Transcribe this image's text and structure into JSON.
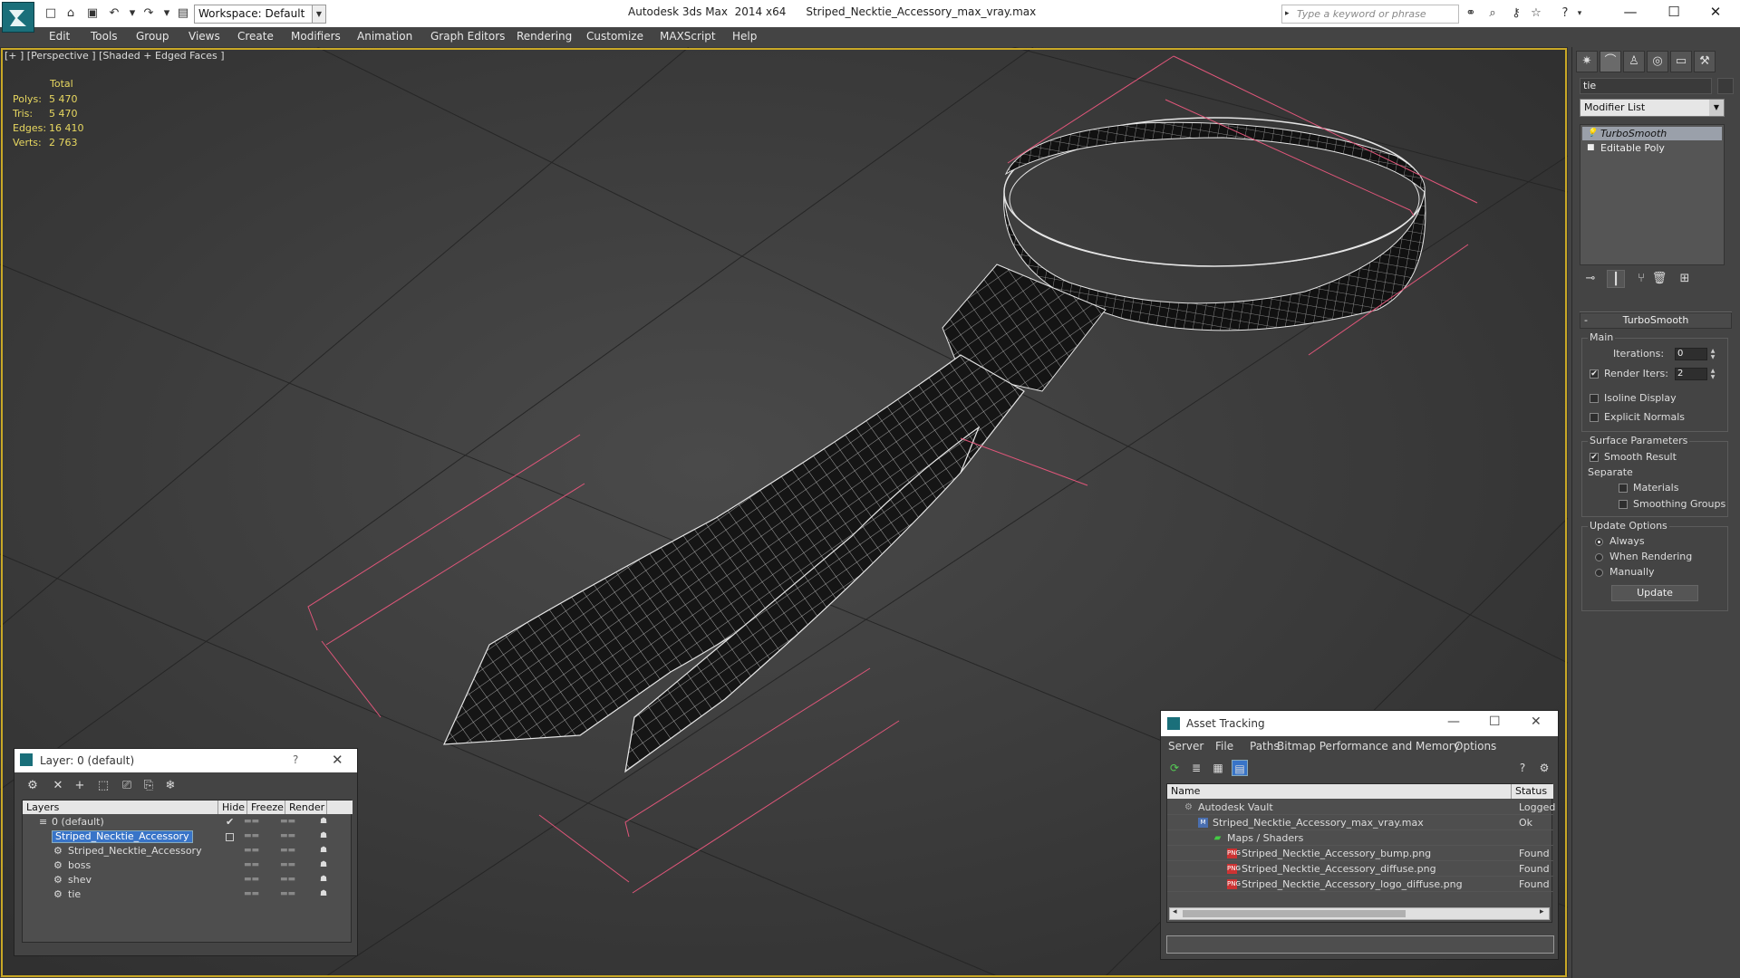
{
  "titlebar": {
    "app": "Autodesk 3ds Max  2014 x64",
    "file": "Striped_Necktie_Accessory_max_vray.max",
    "workspace": "Workspace: Default",
    "search_placeholder": "Type a keyword or phrase",
    "icons": [
      "new-icon",
      "open-icon",
      "save-icon",
      "undo-icon",
      "redo-icon",
      "project-icon"
    ],
    "right_tools": [
      "binoculars-icon",
      "search-icon",
      "key-icon",
      "star-icon",
      "help-icon"
    ],
    "controls": {
      "minimize": "—",
      "maximize": "☐",
      "close": "✕"
    }
  },
  "menu": [
    "Edit",
    "Tools",
    "Group",
    "Views",
    "Create",
    "Modifiers",
    "Animation",
    "Graph Editors",
    "Rendering",
    "Customize",
    "MAXScript",
    "Help"
  ],
  "viewport": {
    "label": "[+ ] [Perspective ] [Shaded + Edged Faces ]",
    "stats": {
      "header": "Total",
      "rows": [
        {
          "k": "Polys:",
          "v": "5 470"
        },
        {
          "k": "Tris:",
          "v": "5 470"
        },
        {
          "k": "Edges:",
          "v": "16 410"
        },
        {
          "k": "Verts:",
          "v": "2 763"
        }
      ]
    }
  },
  "command_panel": {
    "object_name": "tie",
    "modifier_list": "Modifier List",
    "stack": [
      "TurboSmooth",
      "Editable Poly"
    ],
    "rollout_title": "TurboSmooth",
    "main": {
      "title": "Main",
      "iterations_label": "Iterations:",
      "iterations_value": "0",
      "render_iters_label": "Render Iters:",
      "render_iters_value": "2",
      "isoline_label": "Isoline Display",
      "explicit_normals_label": "Explicit Normals"
    },
    "surface": {
      "title": "Surface Parameters",
      "smooth_result_label": "Smooth Result",
      "separate_label": "Separate",
      "materials_label": "Materials",
      "smoothing_groups_label": "Smoothing Groups"
    },
    "update": {
      "title": "Update Options",
      "always": "Always",
      "when_rendering": "When Rendering",
      "manually": "Manually",
      "button": "Update"
    }
  },
  "layer_dialog": {
    "title": "Layer: 0 (default)",
    "help": "?",
    "close": "✕",
    "columns": [
      "Layers",
      "Hide",
      "Freeze",
      "Render"
    ],
    "rows": [
      {
        "name": "0 (default)",
        "checked": "✔"
      },
      {
        "name": "Striped_Necktie_Accessory"
      },
      {
        "name": "Striped_Necktie_Accessory"
      },
      {
        "name": "boss"
      },
      {
        "name": "shev"
      },
      {
        "name": "tie"
      }
    ]
  },
  "asset_dialog": {
    "title": "Asset Tracking",
    "menu": [
      "Server",
      "File",
      "Paths",
      "Bitmap Performance and Memory",
      "Options"
    ],
    "columns": [
      "Name",
      "Status"
    ],
    "rows": [
      {
        "name": "Autodesk Vault",
        "status": "Logged"
      },
      {
        "name": "Striped_Necktie_Accessory_max_vray.max",
        "status": "Ok"
      },
      {
        "name": "Maps / Shaders",
        "status": ""
      },
      {
        "name": "Striped_Necktie_Accessory_bump.png",
        "status": "Found"
      },
      {
        "name": "Striped_Necktie_Accessory_diffuse.png",
        "status": "Found"
      },
      {
        "name": "Striped_Necktie_Accessory_logo_diffuse.png",
        "status": "Found"
      }
    ],
    "file_icon": "PNG"
  }
}
